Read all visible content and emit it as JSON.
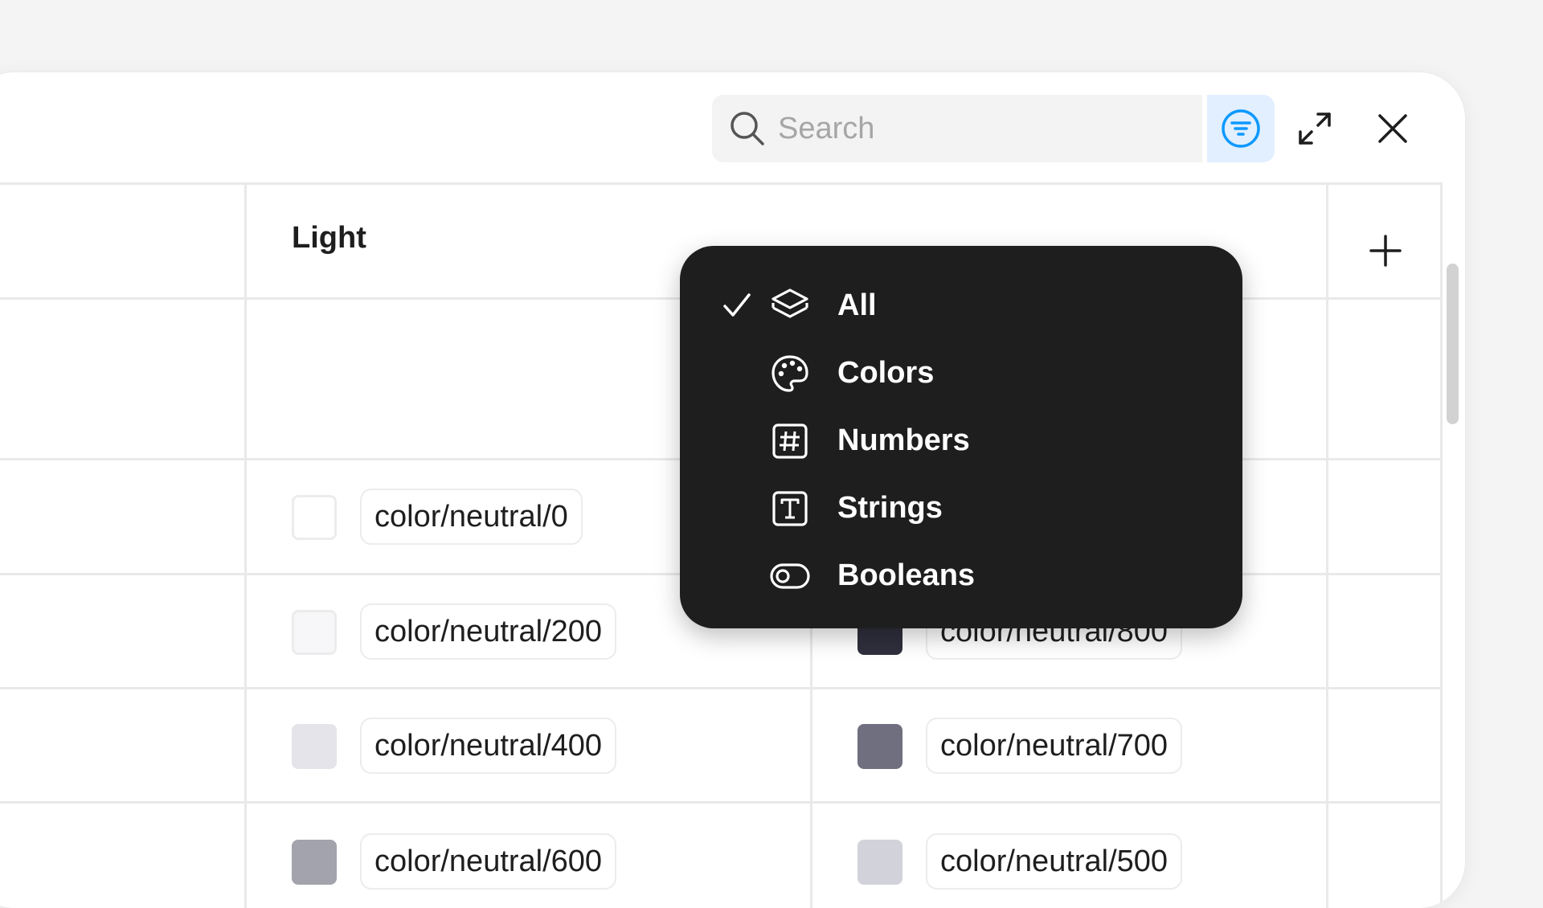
{
  "toolbar": {
    "search_placeholder": "Search",
    "filter_icon": "filter-icon",
    "expand_icon": "expand-icon",
    "close_icon": "close-icon"
  },
  "table": {
    "column_header": "Light",
    "add_column_icon": "plus-icon",
    "rows": [
      {
        "light_swatch": "#ffffff",
        "light_label": "color/neutral/0",
        "dark_swatch": "",
        "dark_label": ""
      },
      {
        "light_swatch": "#f7f7f9",
        "light_label": "color/neutral/200",
        "dark_swatch": "#2f2f3d",
        "dark_label": "color/neutral/800"
      },
      {
        "light_swatch": "#e4e4ea",
        "light_label": "color/neutral/400",
        "dark_swatch": "#6f6f80",
        "dark_label": "color/neutral/700"
      },
      {
        "light_swatch": "#a3a3ad",
        "light_label": "color/neutral/600",
        "dark_swatch": "#d2d2da",
        "dark_label": "color/neutral/500"
      }
    ]
  },
  "filter_menu": {
    "selected": "All",
    "items": [
      {
        "label": "All",
        "icon": "layers-icon",
        "checked": true
      },
      {
        "label": "Colors",
        "icon": "palette-icon",
        "checked": false
      },
      {
        "label": "Numbers",
        "icon": "hash-icon",
        "checked": false
      },
      {
        "label": "Strings",
        "icon": "text-icon",
        "checked": false
      },
      {
        "label": "Booleans",
        "icon": "toggle-icon",
        "checked": false
      }
    ]
  },
  "colors": {
    "accent": "#0d99ff",
    "accent_bg": "#e1efff",
    "menu_bg": "#1e1e1e"
  }
}
